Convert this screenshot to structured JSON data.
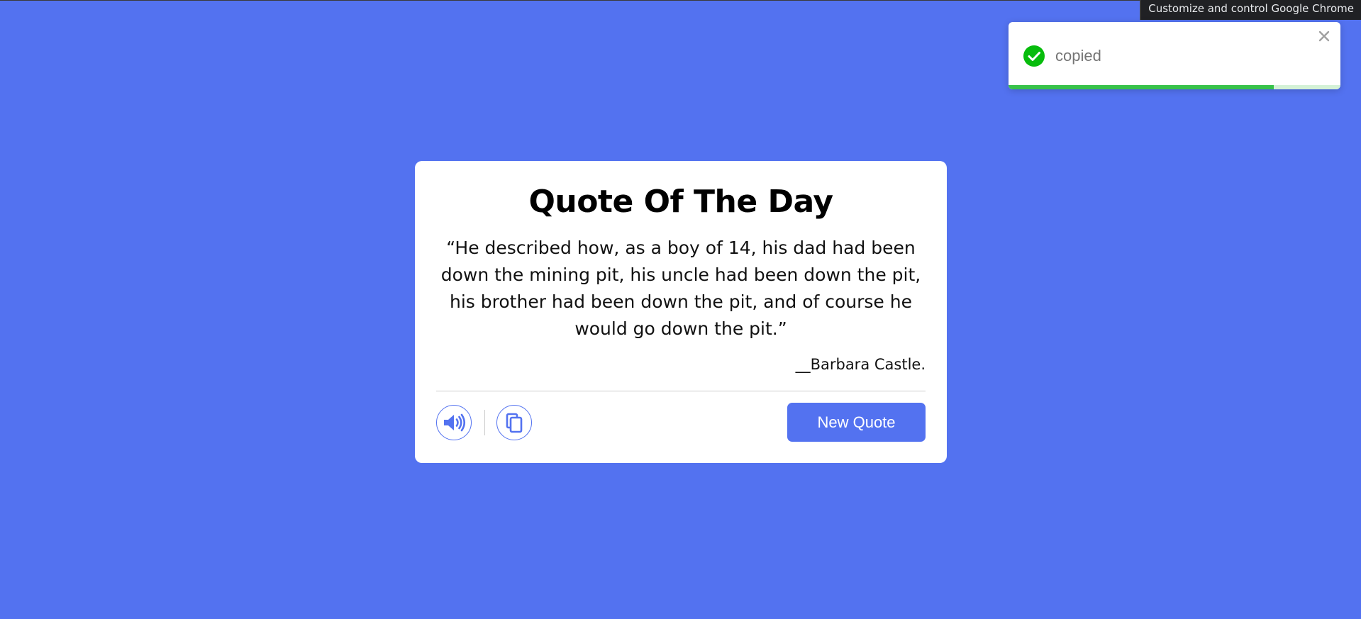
{
  "browser": {
    "tooltip": "Customize and control Google Chrome"
  },
  "toast": {
    "message": "copied",
    "status_icon": "check-circle-icon",
    "close_icon": "close-icon",
    "progress_remaining": 0.8,
    "colors": {
      "success": "#07bc0c",
      "progress": "#38c24a",
      "track": "#d4f1d6"
    }
  },
  "card": {
    "title": "Quote Of The Day",
    "quote": "“He described how, as a boy of 14, his dad had been down the mining pit, his uncle had been down the pit, his brother had been down the pit, and of course he would go down the pit.”",
    "author": "__Barbara Castle.",
    "speech_icon": "speaker-icon",
    "copy_icon": "copy-icon",
    "new_quote_label": "New Quote"
  },
  "colors": {
    "background": "#5372F0",
    "accent": "#5372F0",
    "card": "#ffffff"
  }
}
